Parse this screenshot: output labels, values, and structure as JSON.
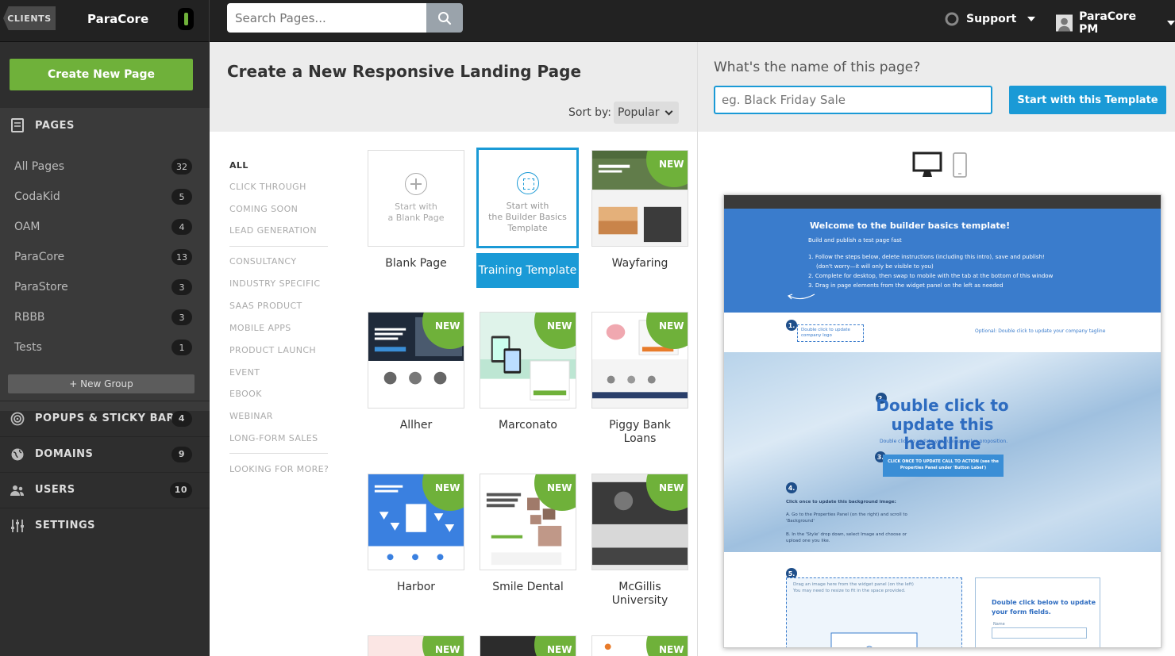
{
  "topbar": {
    "clients_label": "CLIENTS",
    "brand": "ParaCore",
    "search_placeholder": "Search Pages...",
    "support_label": "Support",
    "user_label": "ParaCore PM"
  },
  "sidebar": {
    "create_label": "Create New Page",
    "pages_header": "PAGES",
    "groups": [
      {
        "label": "All Pages",
        "count": "32"
      },
      {
        "label": "CodaKid",
        "count": "5"
      },
      {
        "label": "OAM",
        "count": "4"
      },
      {
        "label": "ParaCore",
        "count": "13"
      },
      {
        "label": "ParaStore",
        "count": "3"
      },
      {
        "label": "RBBB",
        "count": "3"
      },
      {
        "label": "Tests",
        "count": "1"
      }
    ],
    "new_group_label": "+ New Group",
    "sections": [
      {
        "label": "POPUPS & STICKY BARS",
        "count": "4",
        "icon": "target-icon"
      },
      {
        "label": "DOMAINS",
        "count": "9",
        "icon": "globe-icon"
      },
      {
        "label": "USERS",
        "count": "10",
        "icon": "users-icon"
      },
      {
        "label": "SETTINGS",
        "count": "",
        "icon": "sliders-icon"
      }
    ]
  },
  "center": {
    "title": "Create a New Responsive Landing Page",
    "sort_label": "Sort by:",
    "sort_value": "Popular",
    "categories": [
      "ALL",
      "CLICK THROUGH",
      "COMING SOON",
      "LEAD GENERATION",
      "CONSULTANCY",
      "INDUSTRY SPECIFIC",
      "SAAS PRODUCT",
      "MOBILE APPS",
      "PRODUCT LAUNCH",
      "EVENT",
      "EBOOK",
      "WEBINAR",
      "LONG-FORM SALES",
      "LOOKING FOR MORE?"
    ],
    "blank_tile_text": [
      "Start with",
      "a Blank Page"
    ],
    "builder_tile_text": [
      "Start with",
      "the Builder Basics",
      "Template"
    ],
    "new_badge": "NEW",
    "templates": [
      {
        "name": "Blank Page"
      },
      {
        "name": "Training Template"
      },
      {
        "name": "Wayfaring"
      },
      {
        "name": "Allher"
      },
      {
        "name": "Marconato"
      },
      {
        "name": "Piggy Bank Loans"
      },
      {
        "name": "Harbor"
      },
      {
        "name": "Smile Dental"
      },
      {
        "name": "McGillis University"
      }
    ]
  },
  "right": {
    "question": "What's the name of this page?",
    "name_placeholder": "eg. Black Friday Sale",
    "start_label": "Start with this Template",
    "preview": {
      "welcome": "Welcome to the builder basics template!",
      "subtitle": "Build and publish a test page fast",
      "steps": [
        "1.  Follow the steps below, delete instructions (including this intro), save and publish!",
        "(don't worry—it will only be visible to you)",
        "2.  Complete for desktop, then swap to mobile with the tab at the bottom of this window",
        "3.  Drag in page elements from the widget panel on the left as needed"
      ],
      "logo_text": "Double click to update company logo",
      "tagline": "Optional: Double click to update your company tagline",
      "headline": "Double click to update this headline",
      "value_prop": "Double click to update your unique value proposition.",
      "cta": "CLICK ONCE TO UPDATE CALL TO ACTION (see the Properties Panel under 'Button Label')",
      "bg_title": "Click once to update this background image:",
      "bg_a": "A. Go to the Properties Panel (on the right) and scroll to 'Background'",
      "bg_b": "B. In the 'Style' drop down, select Image and choose or upload one you like.",
      "drag_text": "Drag an image here from the widget panel (on the left)",
      "drag_text2": "You may need to resize to fit in the space provided.",
      "form_title": "Double click below to update your form fields.",
      "form_name": "Name"
    },
    "accent": "#1a9ad6"
  }
}
